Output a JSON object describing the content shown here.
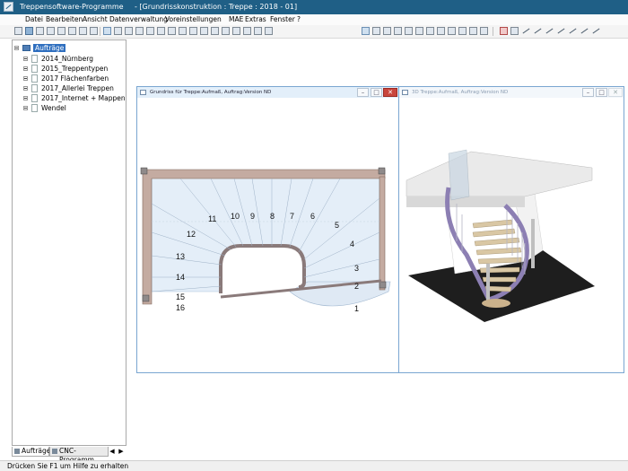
{
  "title_bar": {
    "app_title": "Treppensoftware-Programme",
    "document_title": "- [Grundrisskonstruktion : Treppe : 2018 - 01]"
  },
  "menu": {
    "items": [
      "Datei",
      "Bearbeiten",
      "Ansicht",
      "Datenverwaltung",
      "Voreinstellungen",
      "MAE",
      "Extras",
      "Fenster",
      "?"
    ]
  },
  "tree": {
    "root": "Aufträge",
    "items": [
      "2014_Nürnberg",
      "2015_Treppentypen",
      "2017 Flächenfarben",
      "2017_Allerlei Treppen",
      "2017_Internet + Mappen",
      "Wendel"
    ]
  },
  "bottom_tabs": [
    "Aufträge",
    "CNC-Programm"
  ],
  "status_bar": {
    "text": "Drücken Sie  F1  um Hilfe zu erhalten"
  },
  "windows": {
    "floorplan": {
      "title": "Grundriss für Treppe:Aufmaß, Auftrag:Version ND",
      "step_numbers": [
        "1",
        "2",
        "3",
        "4",
        "5",
        "6",
        "7",
        "8",
        "9",
        "10",
        "11",
        "12",
        "13",
        "14",
        "15",
        "16"
      ]
    },
    "view3d": {
      "title": "3D Treppe:Aufmaß, Auftrag:Version ND"
    }
  },
  "colors": {
    "title_bar": "#1f5f86",
    "tree_selection": "#2f6fbf",
    "floorplan_fill": "#e4eef8",
    "wall_frame": "#c4aba1",
    "stringer": "#8a7a7a",
    "floor_3d": "#1e1e1e",
    "stringer_3d": "#8c7fb3"
  }
}
